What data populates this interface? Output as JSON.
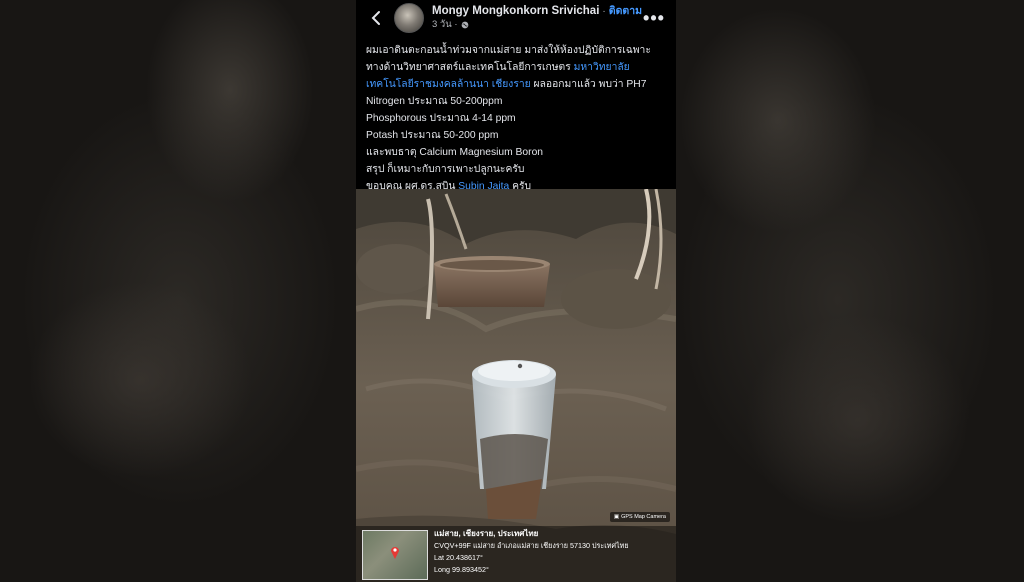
{
  "header": {
    "back_icon": "back-arrow-icon",
    "author_name": "Mongy Mongkonkorn Srivichai",
    "separator": "·",
    "follow_label": "ติดตาม",
    "time_ago": "3 วัน ·",
    "privacy_icon": "globe-icon",
    "more_icon": "more-horizontal-icon"
  },
  "post": {
    "line1": "ผมเอาดินตะกอนน้ำท่วมจากแม่สาย มาส่งให้ห้องปฏิบัติการเฉพาะ",
    "line2": "ทางด้านวิทยาศาสตร์และเทคโนโลยีการเกษตร",
    "link1": "มหาวิทยาลัย",
    "link2": "เทคโนโลยีราชมงคลล้านนา เชียงราย",
    "line3_rest": " ผลออกมาแล้ว พบว่า PH7",
    "line4": "Nitrogen ประมาณ 50-200ppm",
    "line5": "Phosphorous ประมาณ 4-14 ppm",
    "line6": "Potash ประมาณ 50-200 ppm",
    "line7": "และพบธาตุ Calcium Magnesium Boron",
    "line8": "สรุป ก็เหมาะกับการเพาะปลูกนะครับ",
    "line9_pre": "ขอบคุณ ผศ.ดร.สุบิน ",
    "link3": "Subin Jaita",
    "line9_post": "  ครับ"
  },
  "photo": {
    "gps_badge": "GPS Map Camera",
    "gps_title": "แม่สาย, เชียงราย, ประเทศไทย",
    "gps_address": "CVQV+99F แม่สาย อำเภอแม่สาย เชียงราย 57130 ประเทศไทย",
    "gps_lat": "Lat 20.438617°",
    "gps_long": "Long 99.893452°"
  },
  "colors": {
    "background": "#000000",
    "text": "#e4e6eb",
    "link": "#4599ff",
    "secondary": "#b0b3b8"
  }
}
